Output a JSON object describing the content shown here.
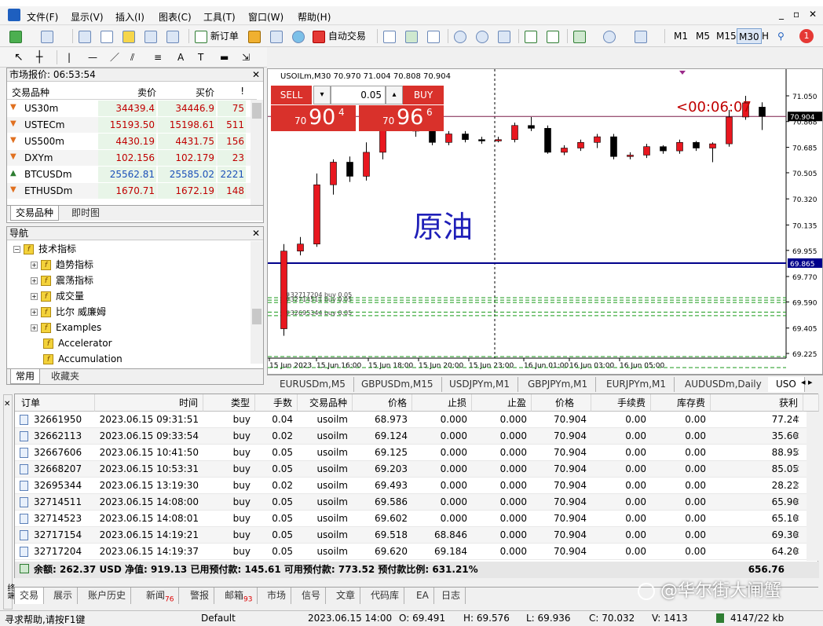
{
  "menu": [
    "文件(F)",
    "显示(V)",
    "插入(I)",
    "图表(C)",
    "工具(T)",
    "窗口(W)",
    "帮助(H)"
  ],
  "toolbar": {
    "new_order": "新订单",
    "auto_trading": "自动交易",
    "timeframes": [
      "M1",
      "M5",
      "M15",
      "M30",
      "H"
    ],
    "notification_count": "1"
  },
  "market_watch": {
    "title": "市场报价: 06:53:54",
    "headers": {
      "symbol": "交易品种",
      "bid": "卖价",
      "ask": "买价",
      "spread": "!"
    },
    "rows": [
      {
        "symbol": "US30m",
        "bid": "34439.4",
        "ask": "34446.9",
        "spread": "75",
        "dir": "down"
      },
      {
        "symbol": "USTECm",
        "bid": "15193.50",
        "ask": "15198.61",
        "spread": "511",
        "dir": "down"
      },
      {
        "symbol": "US500m",
        "bid": "4430.19",
        "ask": "4431.75",
        "spread": "156",
        "dir": "down"
      },
      {
        "symbol": "DXYm",
        "bid": "102.156",
        "ask": "102.179",
        "spread": "23",
        "dir": "down"
      },
      {
        "symbol": "BTCUSDm",
        "bid": "25562.81",
        "ask": "25585.02",
        "spread": "2221",
        "dir": "up"
      },
      {
        "symbol": "ETHUSDm",
        "bid": "1670.71",
        "ask": "1672.19",
        "spread": "148",
        "dir": "down"
      }
    ],
    "tabs": [
      "交易品种",
      "即时图"
    ]
  },
  "navigator": {
    "title": "导航",
    "root": "技术指标",
    "items": [
      "趋势指标",
      "震荡指标",
      "成交量",
      "比尔 威廉姆",
      "Examples"
    ],
    "leaf_items": [
      "Accelerator",
      "Accumulation"
    ],
    "tabs": [
      "常用",
      "收藏夹"
    ]
  },
  "chart": {
    "symbol_info": "USOILm,M30  70.970 71.004 70.808 70.904",
    "sell_label": "SELL",
    "buy_label": "BUY",
    "lot": "0.05",
    "sell_price_small": "70",
    "sell_price_big": "90",
    "sell_price_sup": "4",
    "buy_price_small": "70",
    "buy_price_big": "96",
    "buy_price_sup": "6",
    "countdown": "<00:06:07",
    "overlay_title": "原油",
    "current_price_tag": "70.904",
    "hline_tag": "69.865",
    "order_lines": [
      "#32717204 buy 0.05",
      "#32714511 buy 0.05",
      "#32695344 buy 0.05"
    ],
    "y_ticks": [
      "71.050",
      "70.868",
      "70.685",
      "70.505",
      "70.320",
      "70.135",
      "69.955",
      "69.770",
      "69.590",
      "69.405",
      "69.225"
    ],
    "x_ticks": [
      "15 Jun 2023",
      "15 Jun 16:00",
      "15 Jun 18:00",
      "15 Jun 20:00",
      "15 Jun 23:00",
      "16 Jun 01:00",
      "16 Jun 03:00",
      "16 Jun 05:00"
    ],
    "candles": [
      {
        "o": 69.4,
        "c": 69.95,
        "h": 70.0,
        "l": 69.35
      },
      {
        "o": 69.95,
        "c": 70.0,
        "h": 70.05,
        "l": 69.92
      },
      {
        "o": 70.0,
        "c": 70.42,
        "h": 70.5,
        "l": 69.98
      },
      {
        "o": 70.42,
        "c": 70.58,
        "h": 70.6,
        "l": 70.35
      },
      {
        "o": 70.58,
        "c": 70.48,
        "h": 70.62,
        "l": 70.44
      },
      {
        "o": 70.48,
        "c": 70.65,
        "h": 70.72,
        "l": 70.45
      },
      {
        "o": 70.65,
        "c": 70.82,
        "h": 70.85,
        "l": 70.6
      },
      {
        "o": 70.82,
        "c": 70.82,
        "h": 70.84,
        "l": 70.8
      },
      {
        "o": 70.82,
        "c": 70.8,
        "h": 70.86,
        "l": 70.76
      },
      {
        "o": 70.8,
        "c": 70.72,
        "h": 70.82,
        "l": 70.7
      },
      {
        "o": 70.72,
        "c": 70.78,
        "h": 70.8,
        "l": 70.7
      },
      {
        "o": 70.78,
        "c": 70.74,
        "h": 70.8,
        "l": 70.72
      },
      {
        "o": 70.74,
        "c": 70.73,
        "h": 70.76,
        "l": 70.71
      },
      {
        "o": 70.73,
        "c": 70.74,
        "h": 70.76,
        "l": 70.72
      },
      {
        "o": 70.74,
        "c": 70.84,
        "h": 70.86,
        "l": 70.72
      },
      {
        "o": 70.84,
        "c": 70.82,
        "h": 70.9,
        "l": 70.8
      },
      {
        "o": 70.82,
        "c": 70.65,
        "h": 70.84,
        "l": 70.64
      },
      {
        "o": 70.65,
        "c": 70.68,
        "h": 70.7,
        "l": 70.63
      },
      {
        "o": 70.68,
        "c": 70.72,
        "h": 70.74,
        "l": 70.66
      },
      {
        "o": 70.72,
        "c": 70.76,
        "h": 70.78,
        "l": 70.68
      },
      {
        "o": 70.76,
        "c": 70.62,
        "h": 70.78,
        "l": 70.6
      },
      {
        "o": 70.62,
        "c": 70.63,
        "h": 70.65,
        "l": 70.6
      },
      {
        "o": 70.63,
        "c": 70.69,
        "h": 70.71,
        "l": 70.61
      },
      {
        "o": 70.69,
        "c": 70.66,
        "h": 70.7,
        "l": 70.64
      },
      {
        "o": 70.66,
        "c": 70.72,
        "h": 70.74,
        "l": 70.64
      },
      {
        "o": 70.72,
        "c": 70.68,
        "h": 70.73,
        "l": 70.66
      },
      {
        "o": 70.68,
        "c": 70.71,
        "h": 70.72,
        "l": 70.58
      },
      {
        "o": 70.71,
        "c": 70.9,
        "h": 70.95,
        "l": 70.69
      },
      {
        "o": 70.9,
        "c": 71.0,
        "h": 71.05,
        "l": 70.88
      },
      {
        "o": 70.97,
        "c": 70.904,
        "h": 71.004,
        "l": 70.808
      }
    ]
  },
  "chart_tabs": [
    "EURUSDm,M5",
    "GBPUSDm,M15",
    "USDJPYm,M1",
    "GBPJPYm,M1",
    "EURJPYm,M1",
    "AUDUSDm,Daily",
    "USO"
  ],
  "terminal": {
    "headers": [
      "订单",
      "时间",
      "类型",
      "手数",
      "交易品种",
      "价格",
      "止损",
      "止盈",
      "价格",
      "手续费",
      "库存费",
      "获利"
    ],
    "rows": [
      [
        "32661950",
        "2023.06.15 09:31:51",
        "buy",
        "0.04",
        "usoilm",
        "68.973",
        "0.000",
        "0.000",
        "70.904",
        "0.00",
        "0.00",
        "77.24"
      ],
      [
        "32662113",
        "2023.06.15 09:33:54",
        "buy",
        "0.02",
        "usoilm",
        "69.124",
        "0.000",
        "0.000",
        "70.904",
        "0.00",
        "0.00",
        "35.60"
      ],
      [
        "32667606",
        "2023.06.15 10:41:50",
        "buy",
        "0.05",
        "usoilm",
        "69.125",
        "0.000",
        "0.000",
        "70.904",
        "0.00",
        "0.00",
        "88.95"
      ],
      [
        "32668207",
        "2023.06.15 10:53:31",
        "buy",
        "0.05",
        "usoilm",
        "69.203",
        "0.000",
        "0.000",
        "70.904",
        "0.00",
        "0.00",
        "85.05"
      ],
      [
        "32695344",
        "2023.06.15 13:19:30",
        "buy",
        "0.02",
        "usoilm",
        "69.493",
        "0.000",
        "0.000",
        "70.904",
        "0.00",
        "0.00",
        "28.22"
      ],
      [
        "32714511",
        "2023.06.15 14:08:00",
        "buy",
        "0.05",
        "usoilm",
        "69.586",
        "0.000",
        "0.000",
        "70.904",
        "0.00",
        "0.00",
        "65.90"
      ],
      [
        "32714523",
        "2023.06.15 14:08:01",
        "buy",
        "0.05",
        "usoilm",
        "69.602",
        "0.000",
        "0.000",
        "70.904",
        "0.00",
        "0.00",
        "65.10"
      ],
      [
        "32717154",
        "2023.06.15 14:19:21",
        "buy",
        "0.05",
        "usoilm",
        "69.518",
        "68.846",
        "0.000",
        "70.904",
        "0.00",
        "0.00",
        "69.30"
      ],
      [
        "32717204",
        "2023.06.15 14:19:37",
        "buy",
        "0.05",
        "usoilm",
        "69.620",
        "69.184",
        "0.000",
        "70.904",
        "0.00",
        "0.00",
        "64.20"
      ]
    ],
    "summary": "余额: 262.37 USD  净值: 919.13  已用预付款: 145.61  可用预付款: 773.52  预付款比例: 631.21%",
    "summary_profit": "656.76",
    "tabs": [
      "交易",
      "展示",
      "账户历史",
      "新闻",
      "警报",
      "邮箱",
      "市场",
      "信号",
      "文章",
      "代码库",
      "EA",
      "日志"
    ],
    "news_count": "76",
    "mail_count": "93",
    "side_label": "终端"
  },
  "status": {
    "help": "寻求帮助,请按F1键",
    "profile": "Default",
    "datetime": "2023.06.15 14:00",
    "open": "O: 69.491",
    "high": "H: 69.576",
    "low": "L: 69.936",
    "close": "C: 70.032",
    "volume": "V: 1413",
    "traffic": "4147/22 kb"
  },
  "watermark": "@华尔街大闸蟹"
}
